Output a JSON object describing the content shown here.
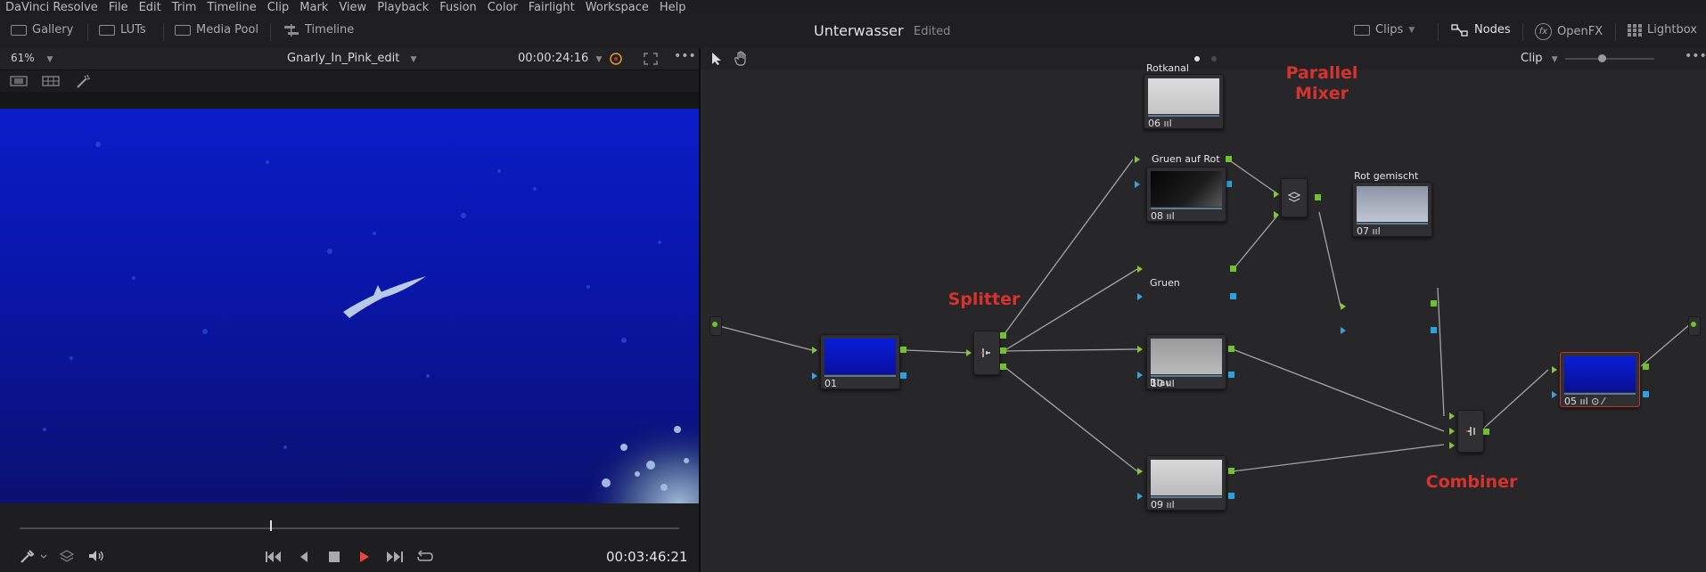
{
  "menu": [
    "DaVinci Resolve",
    "File",
    "Edit",
    "Trim",
    "Timeline",
    "Clip",
    "Mark",
    "View",
    "Playback",
    "Fusion",
    "Color",
    "Fairlight",
    "Workspace",
    "Help"
  ],
  "toolbar": {
    "gallery": "Gallery",
    "luts": "LUTs",
    "media_pool": "Media Pool",
    "timeline": "Timeline",
    "project_title": "Unterwasser",
    "edited": "Edited",
    "clips": "Clips",
    "nodes": "Nodes",
    "openfx": "OpenFX",
    "lightbox": "Lightbox"
  },
  "viewer": {
    "zoom": "61%",
    "clip_name": "Gnarly_In_Pink_edit",
    "source_timecode": "00:00:24:16",
    "record_timecode": "00:03:46:21",
    "playhead_position": 0.38
  },
  "node_editor": {
    "mode": "Clip",
    "labels": {
      "rotkanal": "Rotkanal",
      "gruen_auf_rot": "Gruen auf Rot",
      "rot_gemischt": "Rot gemischt",
      "gruen": "Gruen",
      "blau": "Blau",
      "parallel_mixer": "Parallel\nMixer",
      "splitter": "Splitter",
      "combiner": "Combiner"
    },
    "nodes": [
      {
        "id": "01"
      },
      {
        "id": "06"
      },
      {
        "id": "08"
      },
      {
        "id": "07"
      },
      {
        "id": "10"
      },
      {
        "id": "09"
      },
      {
        "id": "05"
      }
    ]
  },
  "colors": {
    "accent_red": "#d8322f",
    "green_port": "#6fc22d",
    "blue_port": "#2aa2dd"
  }
}
